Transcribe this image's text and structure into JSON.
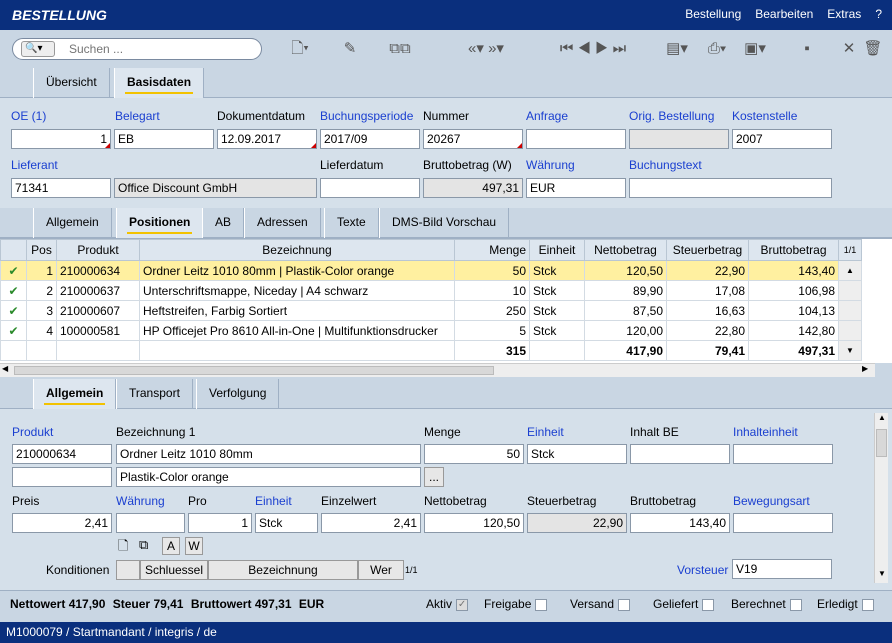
{
  "app": {
    "title": "BESTELLUNG"
  },
  "menu": [
    "Bestellung",
    "Bearbeiten",
    "Extras",
    "?"
  ],
  "search": {
    "placeholder": "Suchen ..."
  },
  "top_tabs": [
    "Übersicht",
    "Basisdaten"
  ],
  "header_fields": {
    "oe": {
      "label": "OE (1)",
      "value": "1"
    },
    "belegart": {
      "label": "Belegart",
      "value": "EB"
    },
    "dokumentdatum": {
      "label": "Dokumentdatum",
      "value": "12.09.2017"
    },
    "buchungsperiode": {
      "label": "Buchungsperiode",
      "value": "2017/09"
    },
    "nummer": {
      "label": "Nummer",
      "value": "20267"
    },
    "anfrage": {
      "label": "Anfrage",
      "value": ""
    },
    "orig_bestellung": {
      "label": "Orig. Bestellung",
      "value": ""
    },
    "kostenstelle": {
      "label": "Kostenstelle",
      "value": "2007"
    },
    "lieferant": {
      "label": "Lieferant",
      "value": "71341"
    },
    "lieferant_name": {
      "value": "Office Discount GmbH"
    },
    "lieferdatum": {
      "label": "Lieferdatum",
      "value": ""
    },
    "bruttobetrag": {
      "label": "Bruttobetrag (W)",
      "value": "497,31"
    },
    "waehrung": {
      "label": "Währung",
      "value": "EUR"
    },
    "buchungstext": {
      "label": "Buchungstext",
      "value": ""
    }
  },
  "mid_tabs": [
    "Allgemein",
    "Positionen",
    "AB",
    "Adressen",
    "Texte",
    "DMS-Bild Vorschau"
  ],
  "grid": {
    "columns": [
      "Pos",
      "Produkt",
      "Bezeichnung",
      "Menge",
      "Einheit",
      "Nettobetrag",
      "Steuerbetrag",
      "Bruttobetrag"
    ],
    "page_indicator": "1/1",
    "rows": [
      {
        "pos": "1",
        "produkt": "210000634",
        "bezeichnung": "Ordner Leitz 1010 80mm | Plastik-Color orange",
        "menge": "50",
        "einheit": "Stck",
        "netto": "120,50",
        "steuer": "22,90",
        "brutto": "143,40"
      },
      {
        "pos": "2",
        "produkt": "210000637",
        "bezeichnung": "Unterschriftsmappe, Niceday | A4 schwarz",
        "menge": "10",
        "einheit": "Stck",
        "netto": "89,90",
        "steuer": "17,08",
        "brutto": "106,98"
      },
      {
        "pos": "3",
        "produkt": "210000607",
        "bezeichnung": "Heftstreifen, Farbig Sortiert",
        "menge": "250",
        "einheit": "Stck",
        "netto": "87,50",
        "steuer": "16,63",
        "brutto": "104,13"
      },
      {
        "pos": "4",
        "produkt": "100000581",
        "bezeichnung": "HP Officejet Pro 8610 All-in-One | Multifunktionsdrucker",
        "menge": "5",
        "einheit": "Stck",
        "netto": "120,00",
        "steuer": "22,80",
        "brutto": "142,80"
      }
    ],
    "totals": {
      "menge": "315",
      "netto": "417,90",
      "steuer": "79,41",
      "brutto": "497,31"
    }
  },
  "bottom_tabs": [
    "Allgemein",
    "Transport",
    "Verfolgung"
  ],
  "detail": {
    "produkt": {
      "label": "Produkt",
      "value": "210000634"
    },
    "bezeichnung1": {
      "label": "Bezeichnung 1",
      "value": "Ordner Leitz 1010 80mm"
    },
    "bezeichnung2": {
      "value": "Plastik-Color orange"
    },
    "menge": {
      "label": "Menge",
      "value": "50"
    },
    "einheit": {
      "label": "Einheit",
      "value": "Stck"
    },
    "inhalt_be": {
      "label": "Inhalt BE",
      "value": ""
    },
    "inhaltseinheit": {
      "label": "Inhalteinheit",
      "value": ""
    },
    "preis": {
      "label": "Preis",
      "value": "2,41"
    },
    "waehrung": {
      "label": "Währung",
      "value": ""
    },
    "pro": {
      "label": "Pro",
      "value": "1"
    },
    "einheit2": {
      "label": "Einheit",
      "value": "Stck"
    },
    "einzelwert": {
      "label": "Einzelwert",
      "value": "2,41"
    },
    "nettobetrag": {
      "label": "Nettobetrag",
      "value": "120,50"
    },
    "steuerbetrag": {
      "label": "Steuerbetrag",
      "value": "22,90"
    },
    "bruttobetrag": {
      "label": "Bruttobetrag",
      "value": "143,40"
    },
    "bewegungsart": {
      "label": "Bewegungsart",
      "value": ""
    },
    "konditionen": {
      "label": "Konditionen",
      "cols": [
        "Schluessel",
        "Bezeichnung",
        "Wer"
      ],
      "page": "1/1"
    },
    "vorsteuer": {
      "label": "Vorsteuer",
      "value": "V19"
    },
    "ellipsis": "...",
    "btn_a": "A",
    "btn_w": "W"
  },
  "summary": {
    "nettowert_label": "Nettowert",
    "nettowert": "417,90",
    "steuer_label": "Steuer",
    "steuer": "79,41",
    "bruttowert_label": "Bruttowert",
    "bruttowert": "497,31",
    "currency": "EUR",
    "flags": [
      "Aktiv",
      "Freigabe",
      "Versand",
      "Geliefert",
      "Berechnet",
      "Erledigt"
    ]
  },
  "status": "M1000079 / Startmandant / integris / de"
}
